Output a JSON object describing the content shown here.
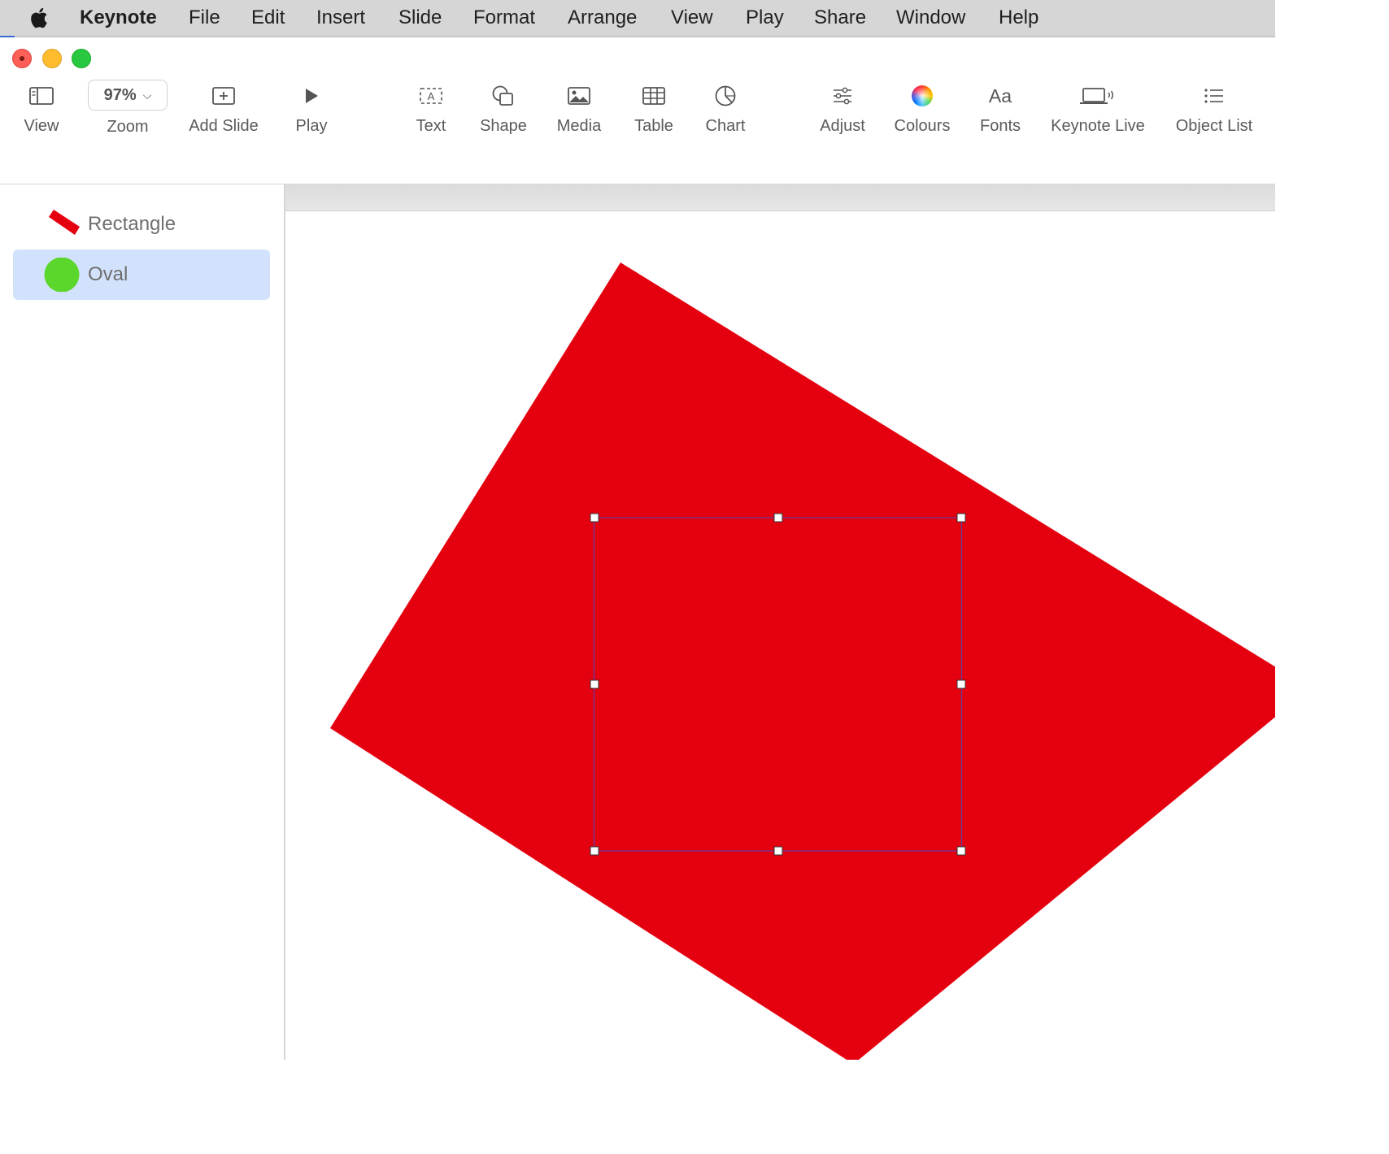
{
  "menubar": {
    "app_name": "Keynote",
    "items": [
      "File",
      "Edit",
      "Insert",
      "Slide",
      "Format",
      "Arrange",
      "View",
      "Play",
      "Share",
      "Window",
      "Help"
    ]
  },
  "toolbar": {
    "view_label": "View",
    "zoom_value": "97%",
    "zoom_label": "Zoom",
    "add_slide_label": "Add Slide",
    "play_label": "Play",
    "text_label": "Text",
    "shape_label": "Shape",
    "media_label": "Media",
    "table_label": "Table",
    "chart_label": "Chart",
    "adjust_label": "Adjust",
    "colours_label": "Colours",
    "fonts_label": "Fonts",
    "fonts_icon_text": "Aa",
    "keynote_live_label": "Keynote Live",
    "object_list_label": "Object List"
  },
  "object_list": {
    "items": [
      {
        "name": "Rectangle",
        "color": "#e5000f",
        "selected": false,
        "icon": "rotated-rectangle"
      },
      {
        "name": "Oval",
        "color": "#5ad62c",
        "selected": true,
        "icon": "circle"
      }
    ]
  },
  "canvas": {
    "shape_color": "#e5000f",
    "selection_color": "#5b3fa8"
  }
}
